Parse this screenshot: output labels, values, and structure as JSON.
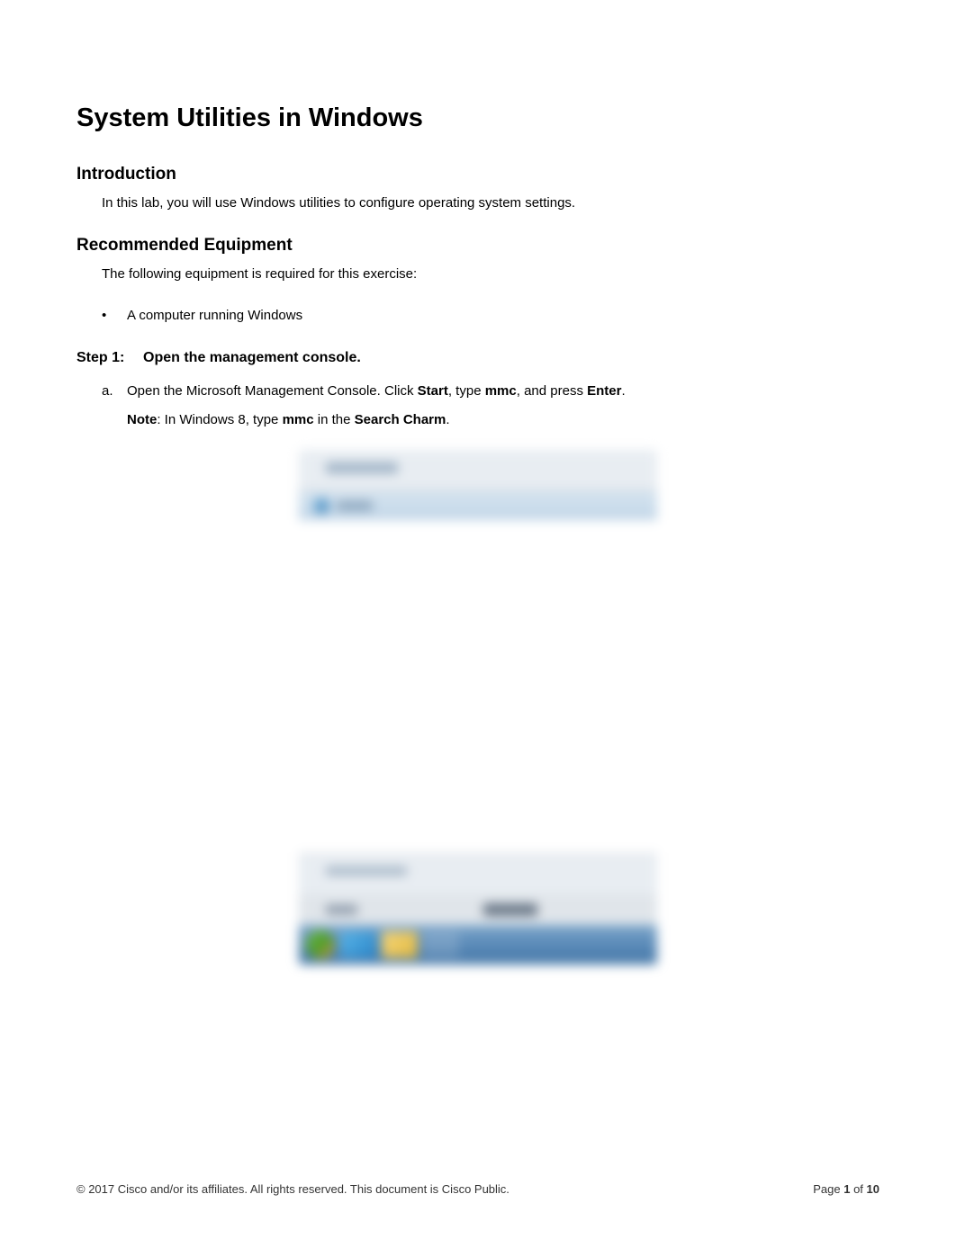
{
  "title": "System Utilities in Windows",
  "sections": {
    "intro": {
      "heading": "Introduction",
      "text": "In this lab, you will use Windows utilities to configure operating system settings."
    },
    "equipment": {
      "heading": "Recommended Equipment",
      "text": "The following equipment is required for this exercise:",
      "bullet": "A computer running Windows"
    },
    "step1": {
      "number": "Step 1:",
      "heading": "Open the management console.",
      "item_letter": "a.",
      "item_prefix": "Open the Microsoft Management Console. Click ",
      "item_bold1": "Start",
      "item_mid1": ", type ",
      "item_bold2": "mmc",
      "item_mid2": ", and press ",
      "item_bold3": "Enter",
      "item_suffix": ".",
      "note_label": "Note",
      "note_mid1": ": In Windows 8, type ",
      "note_bold1": "mmc",
      "note_mid2": " in the ",
      "note_bold2": "Search Charm",
      "note_suffix": "."
    }
  },
  "footer": {
    "copyright": "© 2017 Cisco and/or its affiliates. All rights reserved. This document is Cisco Public.",
    "page_prefix": "Page ",
    "page_current": "1",
    "page_mid": " of ",
    "page_total": "10"
  }
}
